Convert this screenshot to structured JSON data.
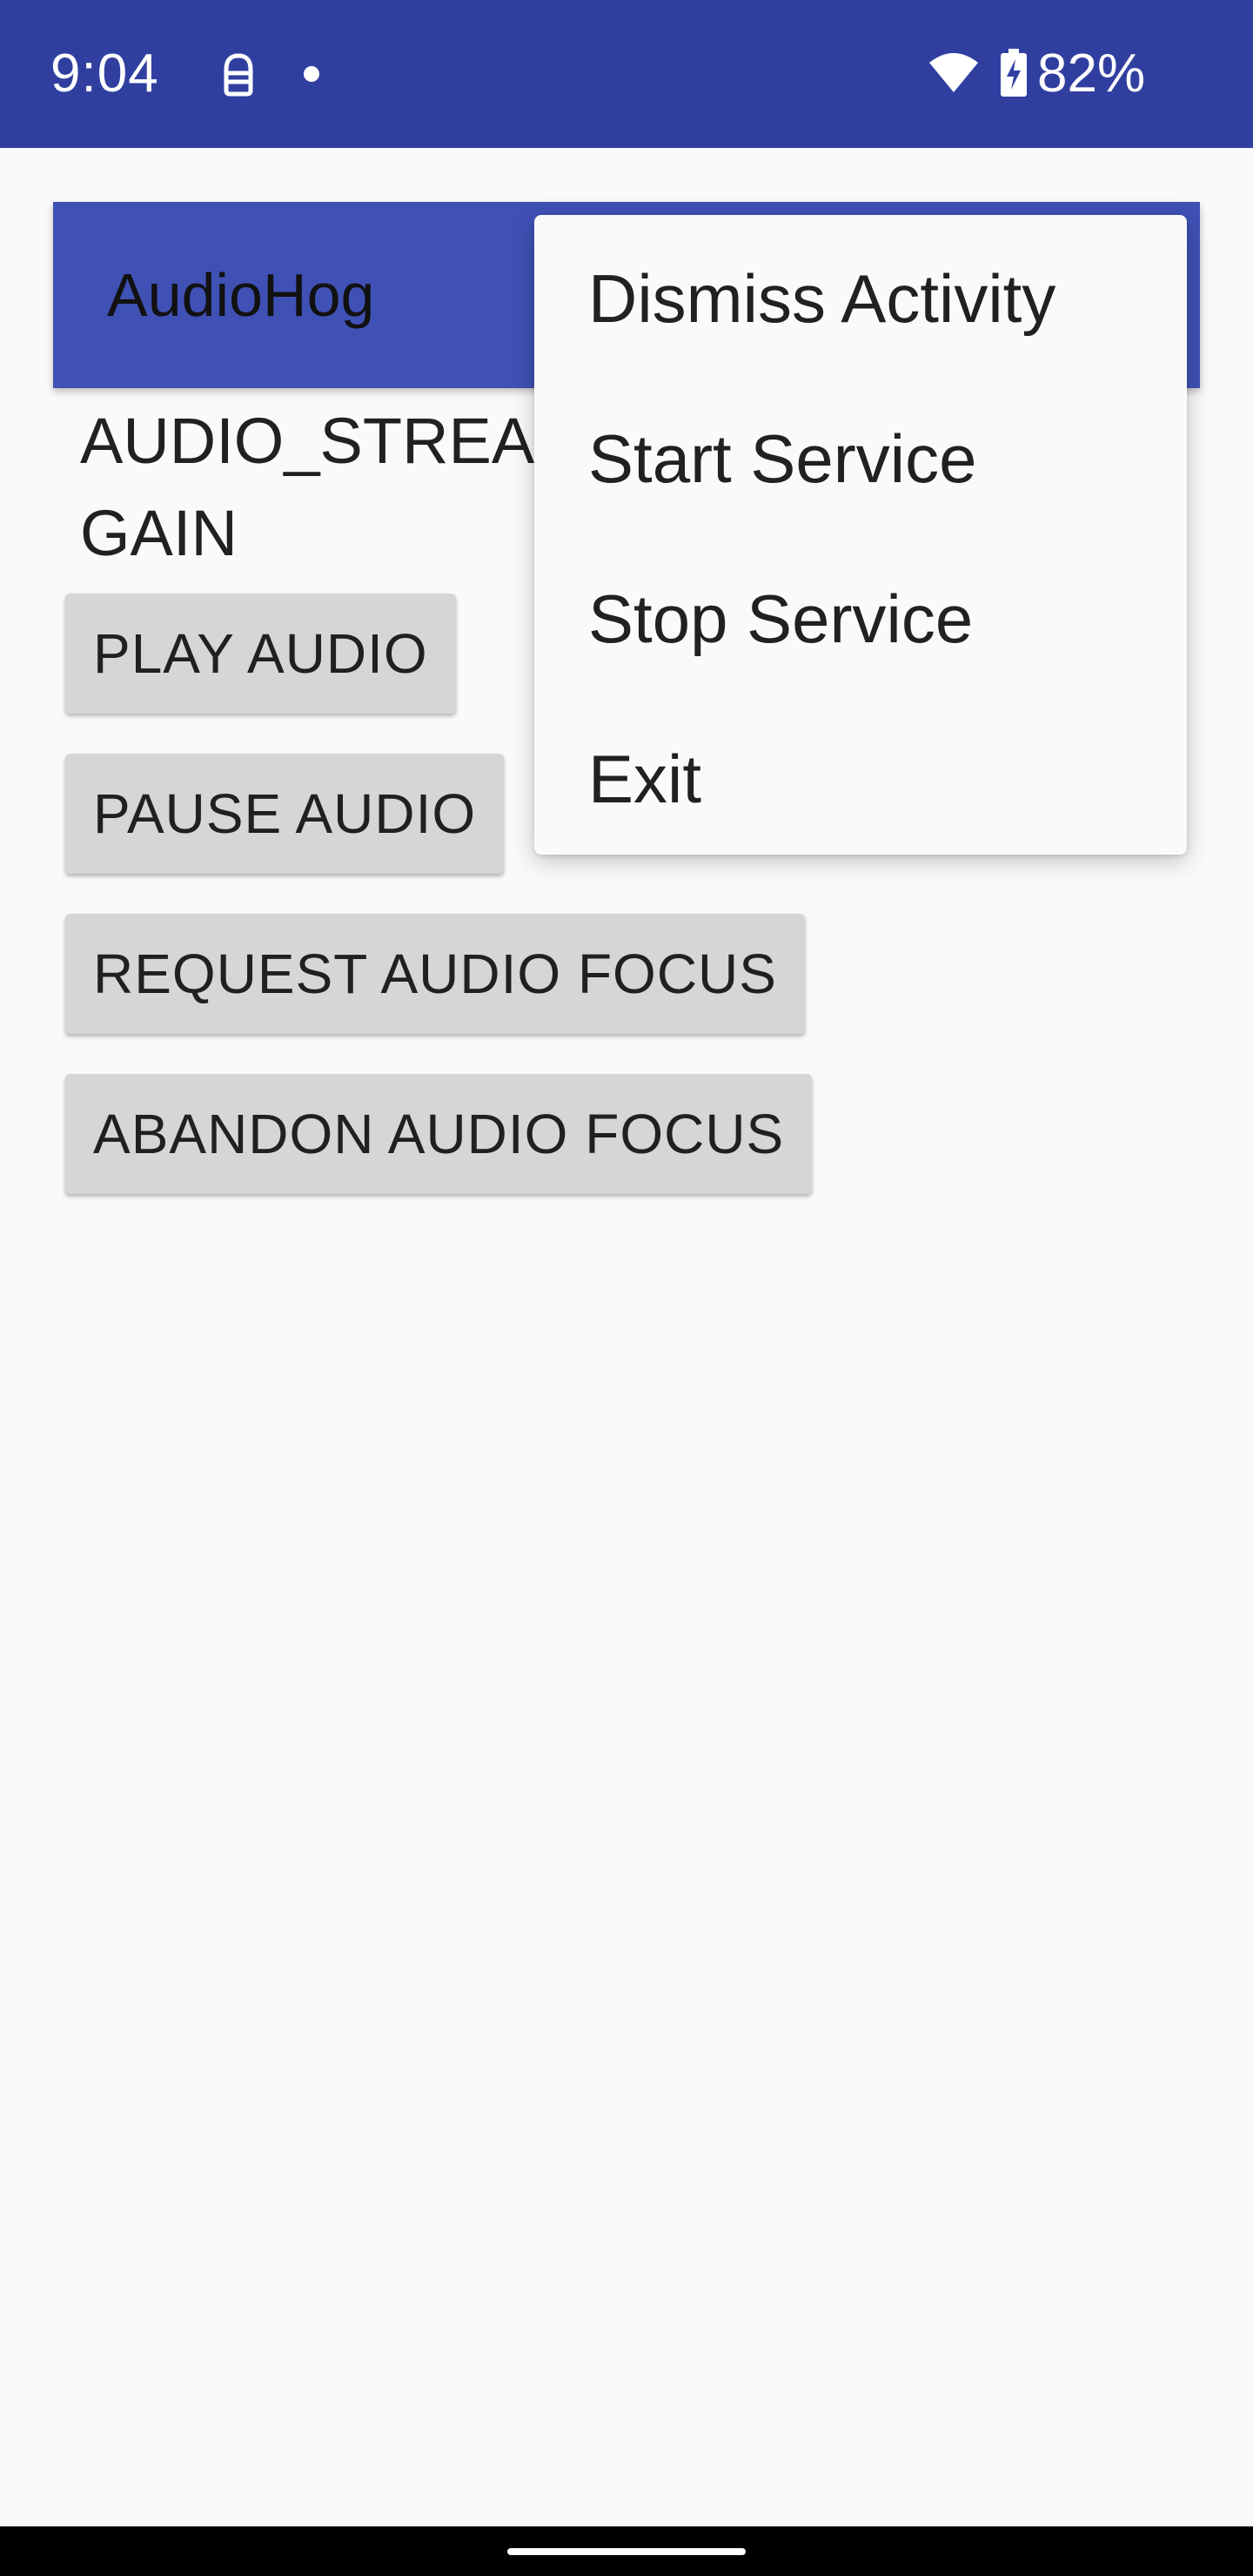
{
  "status_bar": {
    "time": "9:04",
    "battery_percent": "82%",
    "icons": [
      "notification-icon",
      "dot-icon",
      "wifi-icon",
      "battery-charging-icon"
    ],
    "background_color": "#303f9f"
  },
  "app_bar": {
    "title": "AudioHog",
    "background_color": "#3f51b5"
  },
  "main": {
    "status_text": "AUDIO_STREAM\nGAIN",
    "buttons": [
      {
        "label": "Play Audio"
      },
      {
        "label": "Pause Audio"
      },
      {
        "label": "Request Audio Focus"
      },
      {
        "label": "Abandon Audio Focus"
      }
    ]
  },
  "menu": {
    "items": [
      {
        "label": "Dismiss Activity"
      },
      {
        "label": "Start Service"
      },
      {
        "label": "Stop Service"
      },
      {
        "label": "Exit"
      }
    ]
  }
}
